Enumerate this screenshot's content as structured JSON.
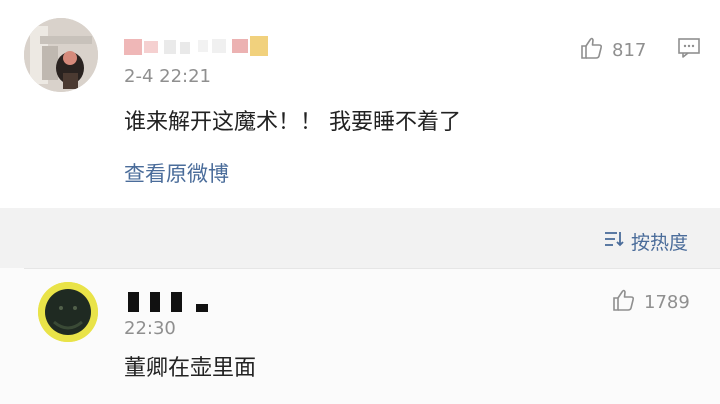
{
  "comments": [
    {
      "time": "2-4 22:21",
      "text": "谁来解开这魔术！！ 我要睡不着了",
      "likes": "817",
      "link_text": "查看原微博"
    },
    {
      "time": "22:30",
      "text": "董卿在壶里面",
      "likes": "1789"
    }
  ],
  "sort": {
    "label": "按热度"
  },
  "colors": {
    "link": "#4a6c9a",
    "muted": "#8f8f8f",
    "text": "#222222",
    "background": "#f2f2f2"
  },
  "icons": {
    "like": "thumbs-up-icon",
    "reply": "comment-icon",
    "sort": "sort-icon"
  }
}
